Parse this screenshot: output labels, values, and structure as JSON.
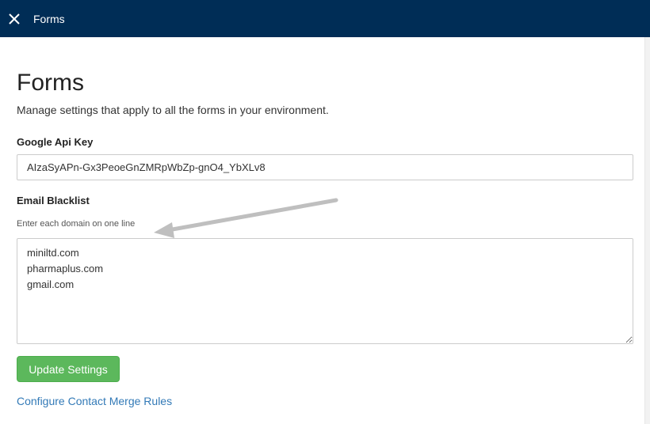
{
  "topbar": {
    "title": "Forms",
    "close_icon": "close-icon",
    "background": "#002d56"
  },
  "page": {
    "title": "Forms",
    "description": "Manage settings that apply to all the forms in your environment."
  },
  "api_key": {
    "label": "Google Api Key",
    "value": "AIzaSyAPn-Gx3PeoeGnZMRpWbZp-gnO4_YbXLv8"
  },
  "blacklist": {
    "label": "Email Blacklist",
    "hint": "Enter each domain on one line",
    "value": "miniltd.com\npharmaplus.com\ngmail.com"
  },
  "actions": {
    "update_label": "Update Settings",
    "update_color": "#5cb85c",
    "merge_rules_link": "Configure Contact Merge Rules",
    "link_color": "#337ab7"
  },
  "annotation": {
    "arrow_color": "#bfbfbf"
  }
}
